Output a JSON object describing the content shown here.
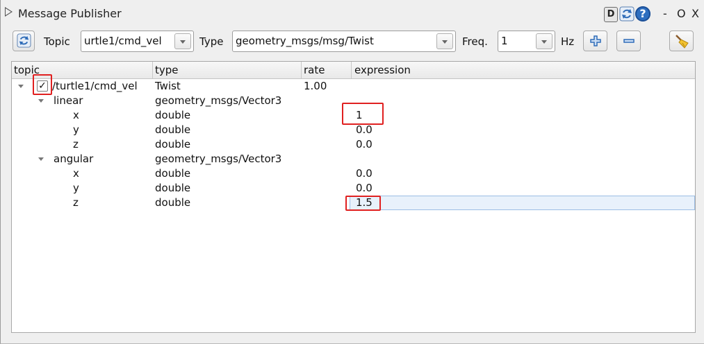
{
  "window": {
    "title": "Message Publisher",
    "dock_label": "D",
    "help_label": "?",
    "minimize_label": "-",
    "restore_label": "O",
    "close_label": "X"
  },
  "toolbar": {
    "topic_label": "Topic",
    "topic_value": "urtle1/cmd_vel",
    "type_label": "Type",
    "type_value": "geometry_msgs/msg/Twist",
    "freq_label": "Freq.",
    "freq_value": "1",
    "hz_label": "Hz"
  },
  "tree": {
    "columns": [
      "topic",
      "type",
      "rate",
      "expression"
    ],
    "rows": [
      {
        "topic": "/turtle1/cmd_vel",
        "type": "Twist",
        "rate": "1.00",
        "expression": "",
        "checked": true
      },
      {
        "topic": "linear",
        "type": "geometry_msgs/Vector3",
        "rate": "",
        "expression": ""
      },
      {
        "topic": "x",
        "type": "double",
        "rate": "",
        "expression": "1"
      },
      {
        "topic": "y",
        "type": "double",
        "rate": "",
        "expression": "0.0"
      },
      {
        "topic": "z",
        "type": "double",
        "rate": "",
        "expression": "0.0"
      },
      {
        "topic": "angular",
        "type": "geometry_msgs/Vector3",
        "rate": "",
        "expression": ""
      },
      {
        "topic": "x",
        "type": "double",
        "rate": "",
        "expression": "0.0"
      },
      {
        "topic": "y",
        "type": "double",
        "rate": "",
        "expression": "0.0"
      },
      {
        "topic": "z",
        "type": "double",
        "rate": "",
        "expression": "1.5"
      }
    ],
    "check_mark": "✓"
  },
  "colors": {
    "highlight_box": "#e02020",
    "selected_row": "#e8f1fb",
    "accent_blue": "#2e6fc0"
  }
}
